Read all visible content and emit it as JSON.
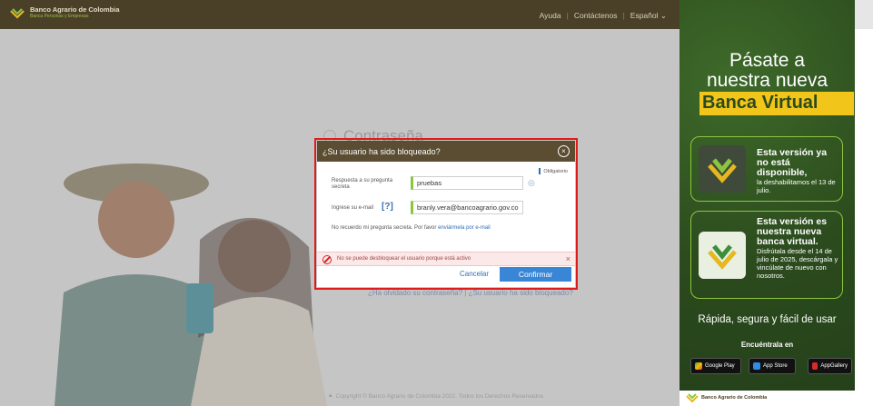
{
  "header": {
    "brand_name": "Banco Agrario de Colombia",
    "brand_tagline": "Banca Personas y Empresas",
    "nav": {
      "help": "Ayuda",
      "contact": "Contáctenos",
      "language": "Español"
    }
  },
  "login_background": {
    "title": "Contraseña",
    "forgot_links": "¿Ha olvidado su contraseña? | ¿Su usuario ha sido bloqueado?",
    "copyright": "Copyright © Banco Agrario de Colombia 2022. Todos los Derechos Reservados"
  },
  "modal": {
    "title": "¿Su usuario ha sido bloqueado?",
    "mandatory_label": "Obligatorio",
    "question_label": "Respuesta a su pregunta secreta",
    "question_value": "pruebas",
    "email_label": "Ingrese su e-mail",
    "email_help": "[?]",
    "email_value": "branly.vera@bancoagrario.gov.co",
    "secret_text": "No recuerdo mi pregunta secreta. Por favor",
    "secret_link": "enviármela por e-mail",
    "alert_text": "No se puede desbloquear el usuario porque está activo",
    "cancel_label": "Cancelar",
    "confirm_label": "Confirmar"
  },
  "promo": {
    "title_line1": "Pásate a",
    "title_line2": "nuestra nueva",
    "title_highlight": "Banca Virtual",
    "card1_bold": "Esta versión ya no está disponible,",
    "card1_text": "la deshabilitamos el 13 de julio.",
    "card2_bold": "Esta versión es nuestra nueva banca virtual.",
    "card2_text": "Disfrútala desde el 14 de julio de 2025, descárgala y vincúlate de nuevo con nosotros.",
    "slogan": "Rápida, segura y fácil de usar",
    "find_label": "Encuéntrala en",
    "stores": [
      "Google Play",
      "App Store",
      "AppGallery"
    ],
    "footer_brand": "Banco Agrario de Colombia"
  },
  "colors": {
    "header_bg": "#4a4028",
    "modal_header": "#5a4d32",
    "confirm_button": "#3a86d6",
    "highlight": "#e01b1b",
    "promo_bg": "#2b4a1d",
    "promo_accent": "#f2c51b"
  }
}
